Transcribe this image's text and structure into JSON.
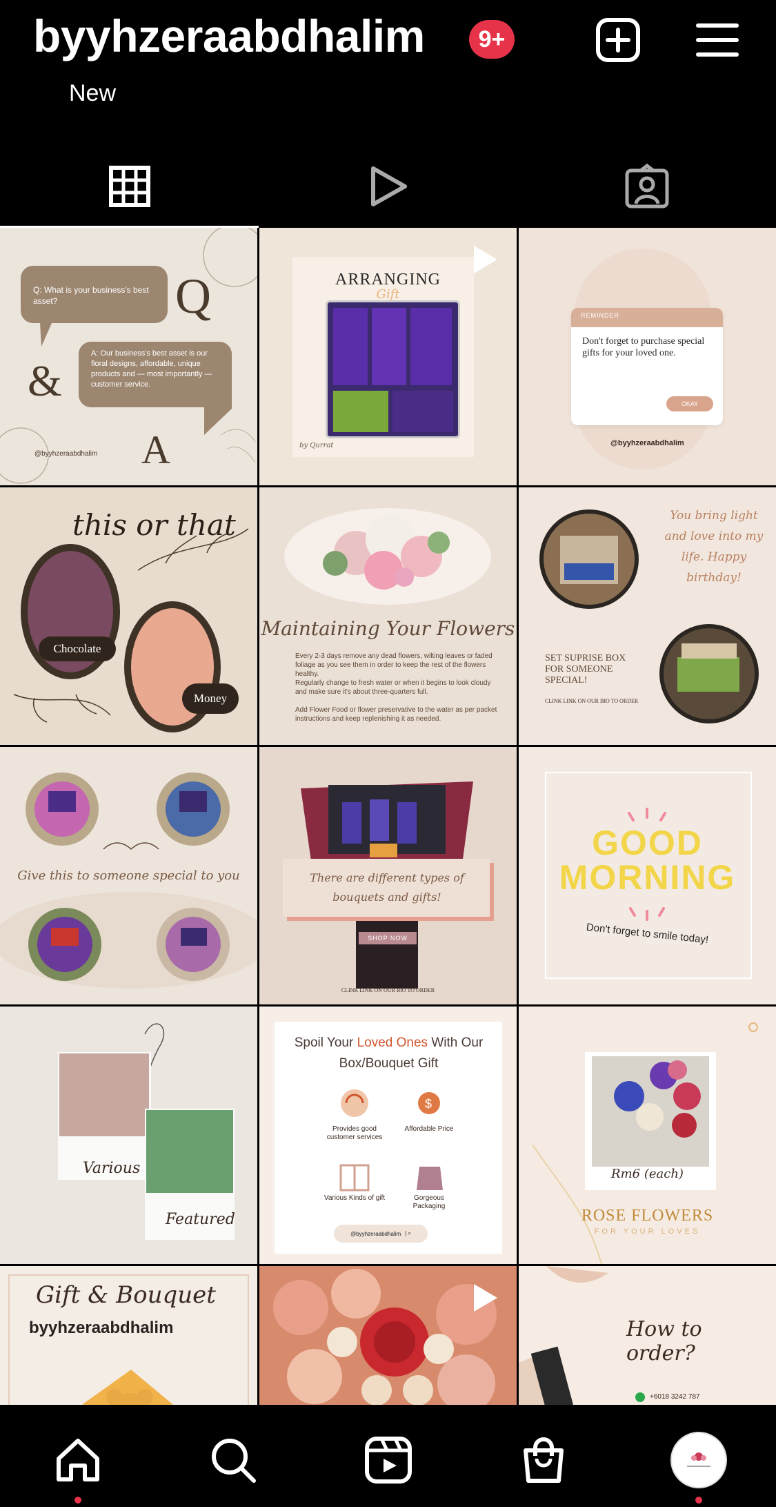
{
  "header": {
    "username": "byyhzeraabdhalim",
    "notification_badge": "9+",
    "add_icon": "plus-square-icon",
    "menu_icon": "hamburger-menu-icon",
    "new_label": "New"
  },
  "tabs": [
    {
      "icon": "grid-icon",
      "active": true
    },
    {
      "icon": "reels-play-icon",
      "active": false
    },
    {
      "icon": "tagged-person-icon",
      "active": false
    }
  ],
  "posts": {
    "p1": {
      "question": "Q: What is your business's best asset?",
      "q": "Q",
      "amp": "&",
      "a": "A",
      "answer": "A: Our business's best asset is our floral designs, affordable, unique products and — most importantly — customer service.",
      "handle": "@byyhzeraabdhalim"
    },
    "p2": {
      "title": "ARRANGING",
      "subtitle": "Gift",
      "sig": "by Qurrat",
      "reel": true
    },
    "p3": {
      "label": "REMINDER",
      "text": "Don't forget to purchase special gifts for your loved one.",
      "button": "OKAY",
      "handle": "@byyhzeraabdhalim"
    },
    "p4": {
      "title": "this or that",
      "opt1": "Chocolate",
      "opt2": "Money"
    },
    "p5": {
      "title": "Maintaining Your Flowers",
      "bullets": [
        "Every 2-3 days remove any dead flowers, wilting leaves or faded foliage as you see them in order to keep the rest of the flowers healthy.",
        "Regularly change to fresh water or when it begins to look cloudy and make sure it's about three-quarters full.",
        "Add Flower Food or flower preservative to the water as per packet instructions and keep replenishing it as needed."
      ]
    },
    "p6": {
      "quote": "You bring light and love into my life. Happy birthday!",
      "title": "SET SUPRISE BOX FOR SOMEONE SPECIAL!",
      "cta": "CLINK LINK ON OUR BIO TO ORDER"
    },
    "p7": {
      "text": "Give this to someone special to you"
    },
    "p8": {
      "text": "There are different types of bouquets and gifts!",
      "button": "SHOP NOW",
      "cta": "CLINK LINK ON OUR BIO TO ORDER"
    },
    "p9": {
      "line1": "GOOD",
      "line2": "MORNING",
      "sub": "Don't forget to smile today!"
    },
    "p10": {
      "label1": "Various",
      "label2": "Featured"
    },
    "p11": {
      "title_a": "Spoil Your ",
      "title_b": "Loved Ones",
      "title_c": " With Our Box/Bouquet Gift",
      "f1": "Provides good customer services",
      "f2": "Affordable Price",
      "f3": "Various Kinds of gift",
      "f4": "Gorgeous Packaging",
      "handle": "@byyhzeraabdhalim"
    },
    "p12": {
      "caption": "Rm6 (each)",
      "title": "ROSE FLOWERS",
      "sub": "FOR YOUR LOVES"
    },
    "p13": {
      "title": "Gift & Bouquet",
      "handle": "byyhzeraabdhalim"
    },
    "p14": {
      "reel": true
    },
    "p15": {
      "title": "How to order?",
      "phone": "+6018 3242 787"
    }
  },
  "bottom_nav": [
    {
      "icon": "home-icon",
      "dot": true
    },
    {
      "icon": "search-icon",
      "dot": false
    },
    {
      "icon": "reels-icon",
      "dot": false
    },
    {
      "icon": "shop-bag-icon",
      "dot": false
    },
    {
      "icon": "profile-avatar-icon",
      "dot": true
    }
  ]
}
